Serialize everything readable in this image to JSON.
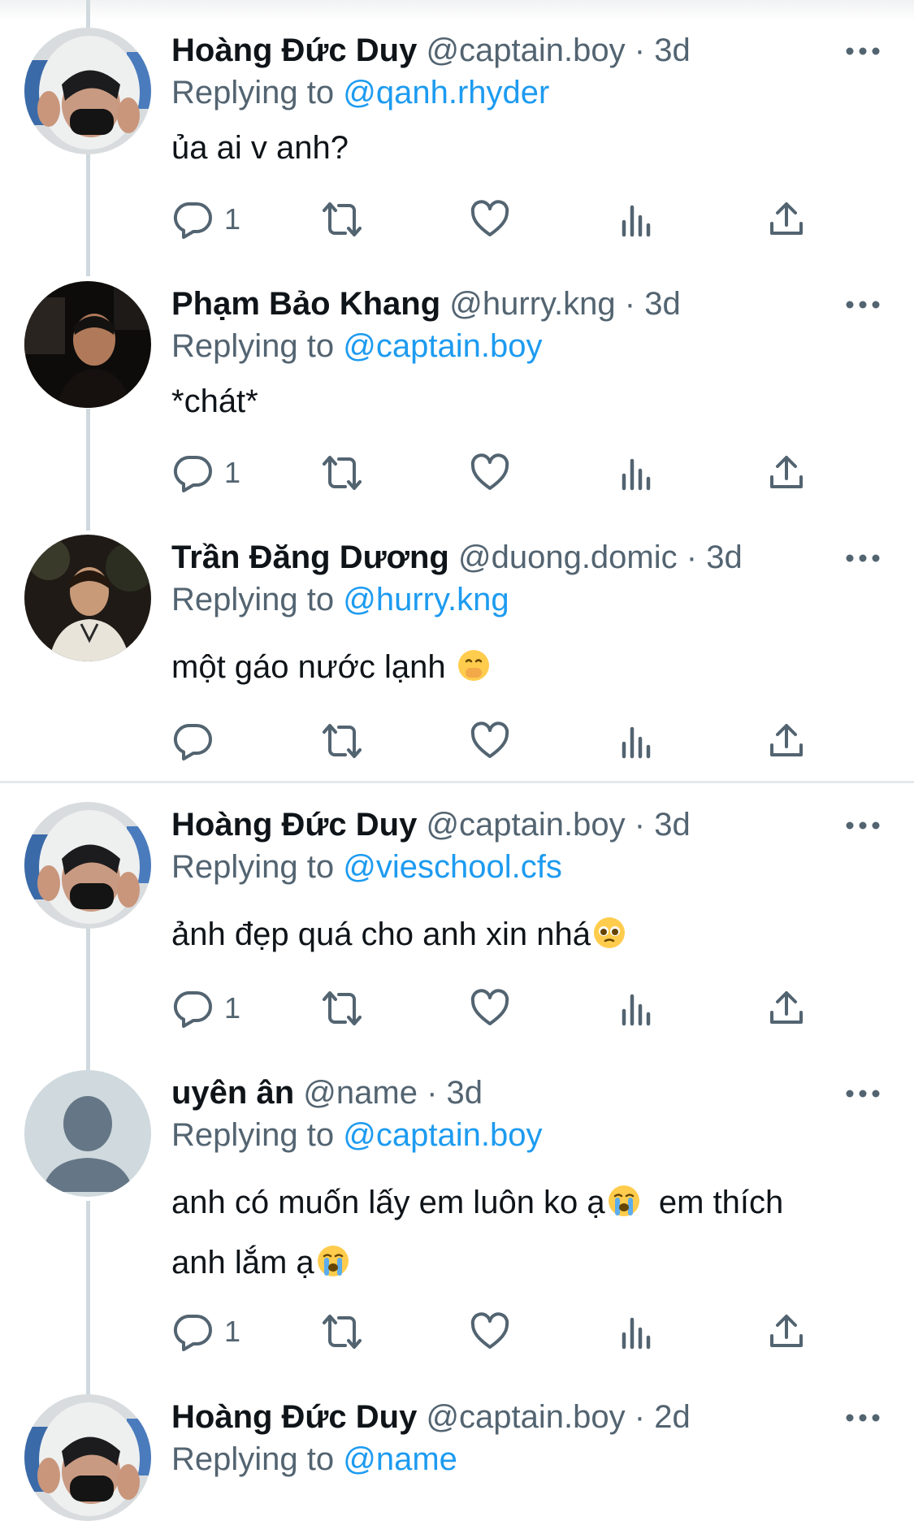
{
  "colors": {
    "accent": "#1d9bf0",
    "muted": "#536471",
    "text": "#0f1419",
    "thread_line": "#cfd9de"
  },
  "tweets": [
    {
      "name": "Hoàng Đức Duy",
      "handle": "@captain.boy",
      "dot": "·",
      "time": "3d",
      "replying_prefix": "Replying to",
      "replying_to": "@qanh.rhyder",
      "text_lines": [
        "ủa ai v anh?"
      ],
      "avatar": "avatar-hoodie-photo",
      "actions": {
        "reply_count": "1",
        "retweet_count": "",
        "like_count": ""
      }
    },
    {
      "name": "Phạm Bảo Khang",
      "handle": "@hurry.kng",
      "dot": "·",
      "time": "3d",
      "replying_prefix": "Replying to",
      "replying_to": "@captain.boy",
      "text_lines": [
        "*chát*"
      ],
      "avatar": "avatar-dark-car-photo",
      "actions": {
        "reply_count": "1",
        "retweet_count": "",
        "like_count": ""
      }
    },
    {
      "name": "Trần Đăng Dương",
      "handle": "@duong.domic",
      "dot": "·",
      "time": "3d",
      "replying_prefix": "Replying to",
      "replying_to": "@hurry.kng",
      "text_lines": [
        "một gáo nước lạnh"
      ],
      "text_emoji": "face-with-hand-over-mouth",
      "avatar": "avatar-night-photo",
      "actions": {
        "reply_count": "",
        "retweet_count": "",
        "like_count": ""
      }
    },
    {
      "name": "Hoàng Đức Duy",
      "handle": "@captain.boy",
      "dot": "·",
      "time": "3d",
      "replying_prefix": "Replying to",
      "replying_to": "@vieschool.cfs",
      "text_lines": [
        "ảnh đẹp quá cho anh xin nhá"
      ],
      "text_emoji": "pleading-face",
      "avatar": "avatar-hoodie-photo",
      "actions": {
        "reply_count": "1",
        "retweet_count": "",
        "like_count": ""
      }
    },
    {
      "name": "uyên ân",
      "handle": "@name",
      "dot": "·",
      "time": "3d",
      "replying_prefix": "Replying to",
      "replying_to": "@captain.boy",
      "text_lines": [
        "anh có muốn lấy em luôn ko ạ",
        "em thích",
        "anh lắm ạ"
      ],
      "text_emoji": "loudly-crying-face",
      "avatar": "default-avatar",
      "actions": {
        "reply_count": "1",
        "retweet_count": "",
        "like_count": ""
      }
    },
    {
      "name": "Hoàng Đức Duy",
      "handle": "@captain.boy",
      "dot": "·",
      "time": "2d",
      "replying_prefix": "Replying to",
      "replying_to": "@name",
      "text_lines": [],
      "avatar": "avatar-hoodie-photo",
      "actions": {
        "reply_count": "",
        "retweet_count": "",
        "like_count": ""
      }
    }
  ],
  "icons": [
    "reply-icon",
    "retweet-icon",
    "like-icon",
    "views-icon",
    "share-icon",
    "more-icon"
  ]
}
